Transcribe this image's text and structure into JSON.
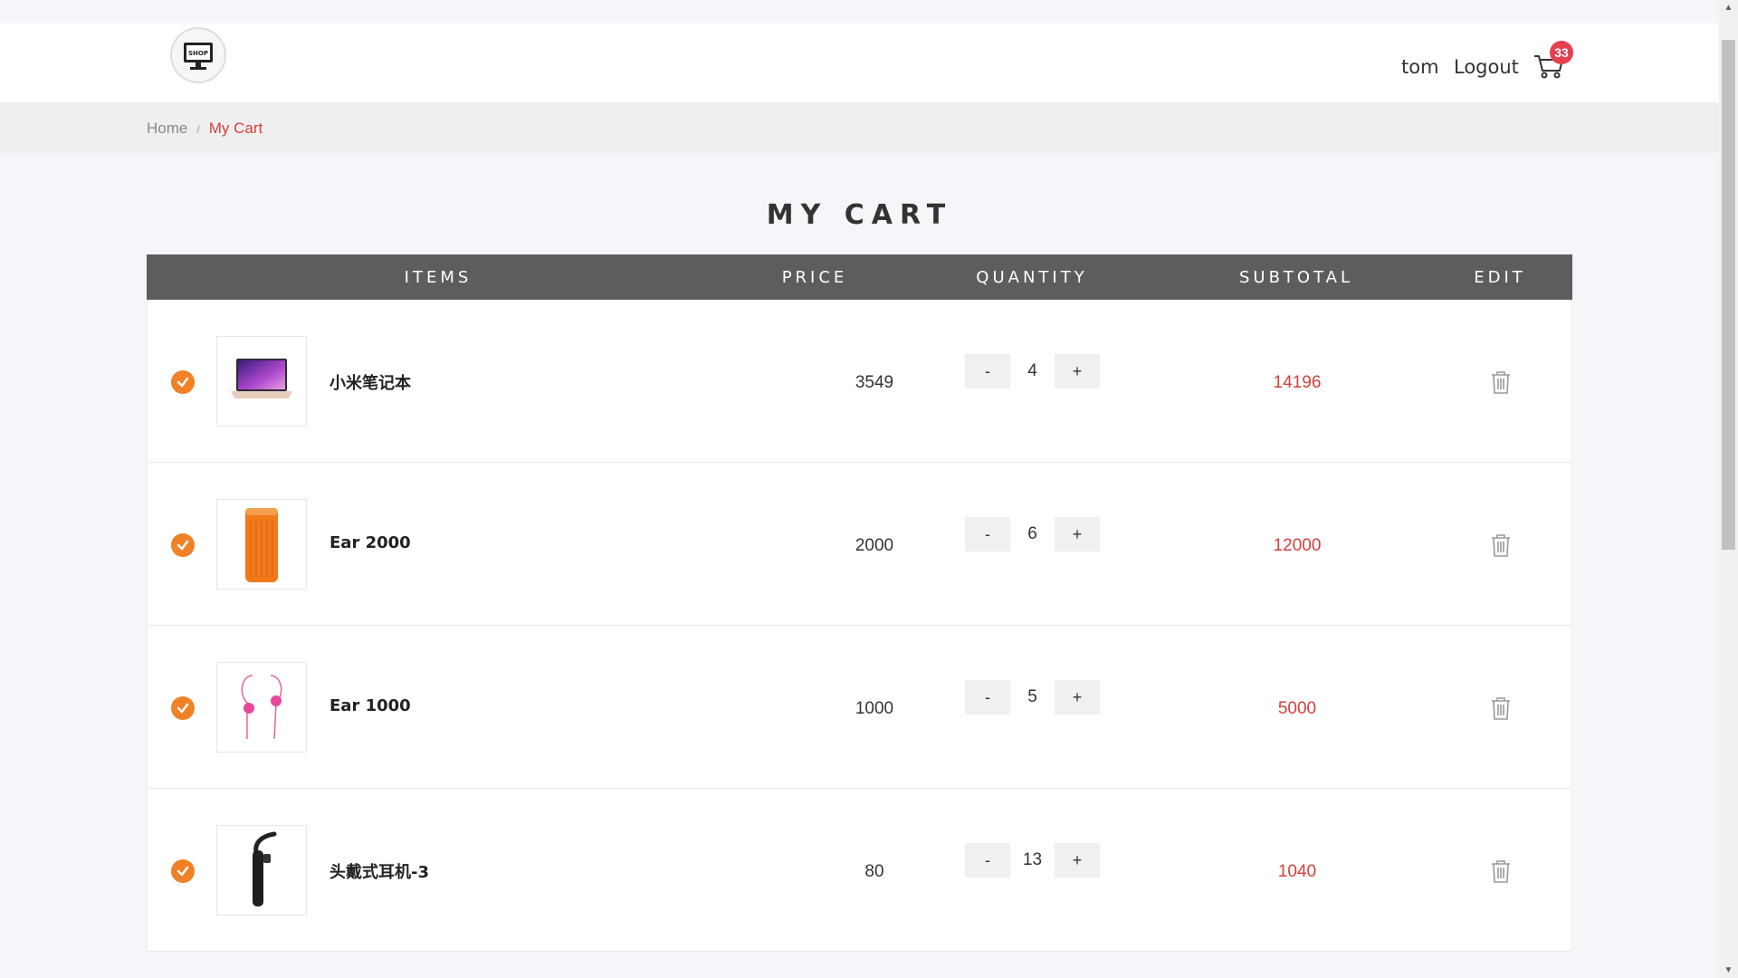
{
  "header": {
    "logo_text": "SHOP",
    "username": "tom",
    "logout_label": "Logout",
    "cart_count": "33"
  },
  "breadcrumb": {
    "home": "Home",
    "separator": "/",
    "current": "My Cart"
  },
  "page_title": "MY CART",
  "table": {
    "columns": [
      "ITEMS",
      "PRICE",
      "QUANTITY",
      "SUBTOTAL",
      "EDIT"
    ],
    "rows": [
      {
        "name": "小米笔记本",
        "price": "3549",
        "quantity": "4",
        "subtotal": "14196",
        "image": "laptop",
        "checked": true
      },
      {
        "name": "Ear 2000",
        "price": "2000",
        "quantity": "6",
        "subtotal": "12000",
        "image": "orange-speaker",
        "checked": true
      },
      {
        "name": "Ear 1000",
        "price": "1000",
        "quantity": "5",
        "subtotal": "5000",
        "image": "pink-earphones",
        "checked": true
      },
      {
        "name": "头戴式耳机-3",
        "price": "80",
        "quantity": "13",
        "subtotal": "1040",
        "image": "black-bluetooth-headset",
        "checked": true
      }
    ],
    "minus_label": "-",
    "plus_label": "+"
  },
  "colors": {
    "accent_red": "#d43f3a",
    "check_orange": "#f08126",
    "table_header": "#5d5d5d"
  }
}
